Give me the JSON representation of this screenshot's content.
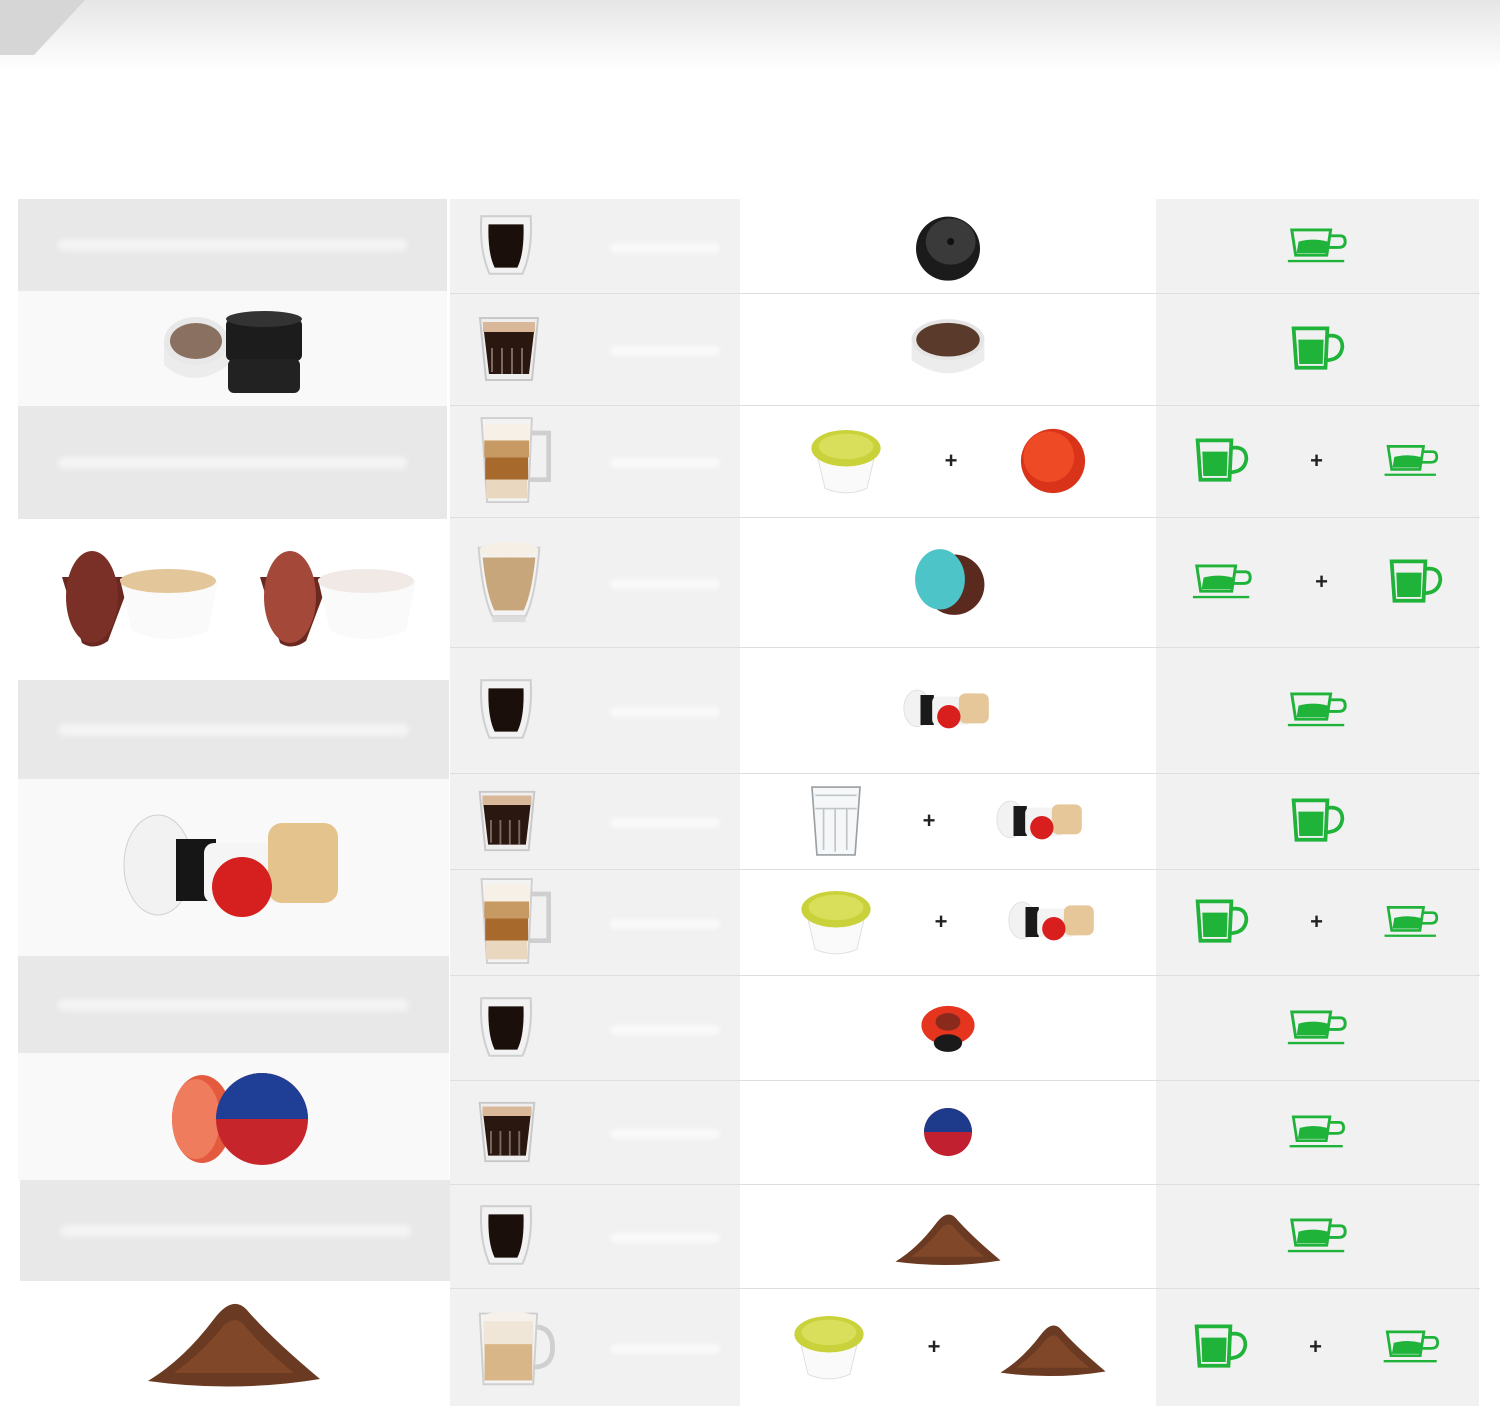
{
  "plus_sign": "+",
  "colors": {
    "cup_green": "#1fb33a",
    "coffee_dark": "#2b1a12",
    "panel_gray": "#e8e8e8"
  },
  "rows": [
    {
      "drink_icon": "espresso-glass-icon",
      "capsules": [
        "lavazza-black-pod-icon"
      ],
      "cups": [
        "espresso-cup-icon"
      ]
    },
    {
      "drink_icon": "short-glass-icon",
      "capsules": [
        "ese-paper-pod-icon"
      ],
      "cups": [
        "mug-icon"
      ]
    },
    {
      "drink_icon": "latte-glass-icon",
      "capsules": [
        "milk-capsule-icon",
        "red-capsule-icon"
      ],
      "cups": [
        "mug-icon",
        "espresso-cup-icon"
      ]
    },
    {
      "drink_icon": "cappuccino-glass-icon",
      "capsules": [
        "teal-capsule-icon"
      ],
      "cups": [
        "espresso-cup-icon",
        "mug-icon"
      ]
    },
    {
      "drink_icon": "espresso-glass-icon",
      "capsules": [
        "nespresso-capsules-icon"
      ],
      "cups": [
        "espresso-cup-icon"
      ]
    },
    {
      "drink_icon": "short-glass-icon",
      "capsules": [
        "water-glass-icon",
        "nespresso-capsules-icon"
      ],
      "cups": [
        "mug-icon"
      ]
    },
    {
      "drink_icon": "latte-glass-icon",
      "capsules": [
        "milk-capsule-icon",
        "nespresso-capsules-icon"
      ],
      "cups": [
        "mug-icon",
        "espresso-cup-icon"
      ]
    },
    {
      "drink_icon": "espresso-glass-icon",
      "capsules": [
        "red-lavazza-capsule-icon"
      ],
      "cups": [
        "espresso-cup-icon"
      ]
    },
    {
      "drink_icon": "short-glass-icon",
      "capsules": [
        "blue-red-capsule-icon"
      ],
      "cups": [
        "mug-icon"
      ]
    },
    {
      "drink_icon": "espresso-glass-icon",
      "capsules": [
        "ground-coffee-icon"
      ],
      "cups": [
        "espresso-cup-icon"
      ]
    },
    {
      "drink_icon": "cappuccino-mug-icon",
      "capsules": [
        "milk-capsule-icon",
        "ground-coffee-icon"
      ],
      "cups": [
        "mug-icon",
        "espresso-cup-icon"
      ]
    }
  ],
  "adapters": [
    {
      "icon": "ese-adapter-icon"
    },
    {
      "icon": "dolce-gusto-adapter-icon"
    },
    {
      "icon": "nespresso-adapter-icon"
    },
    {
      "icon": "lavazza-blue-adapter-icon"
    },
    {
      "icon": "ground-coffee-pile-icon"
    }
  ]
}
